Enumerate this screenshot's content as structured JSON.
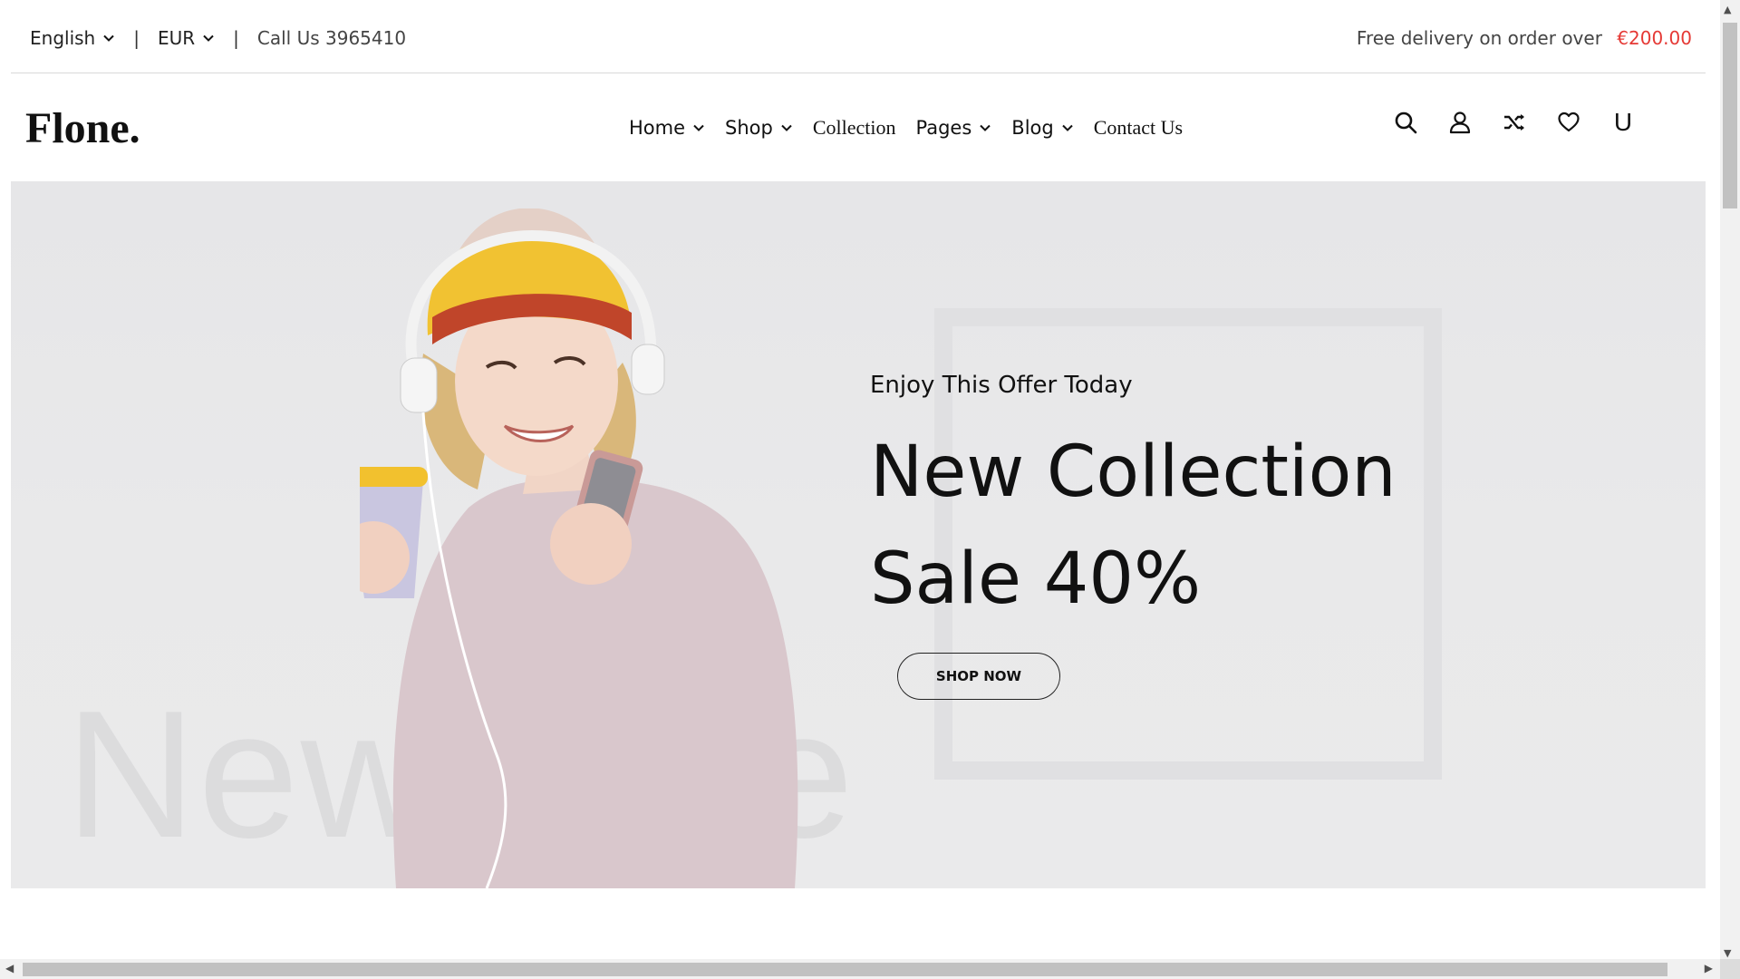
{
  "topbar": {
    "language": "English",
    "currency": "EUR",
    "separator": "|",
    "call_us": "Call Us 3965410",
    "delivery_text": "Free delivery on order over",
    "delivery_amount": "€200.00",
    "accent_color": "#e53935"
  },
  "header": {
    "logo": "Flone.",
    "nav": [
      {
        "label": "Home",
        "has_dropdown": true
      },
      {
        "label": "Shop",
        "has_dropdown": true
      },
      {
        "label": "Collection",
        "has_dropdown": false
      },
      {
        "label": "Pages",
        "has_dropdown": true
      },
      {
        "label": "Blog",
        "has_dropdown": true
      },
      {
        "label": "Contact Us",
        "has_dropdown": false
      }
    ],
    "icons": [
      "search-icon",
      "user-icon",
      "shuffle-icon",
      "heart-icon",
      "cart-icon"
    ],
    "cart_glyph": "U"
  },
  "hero": {
    "subtitle": "Enjoy This Offer Today",
    "title_line1": "New Collection",
    "title_line2": "Sale 40%",
    "button": "SHOP NOW",
    "background_text": "New Sale"
  }
}
